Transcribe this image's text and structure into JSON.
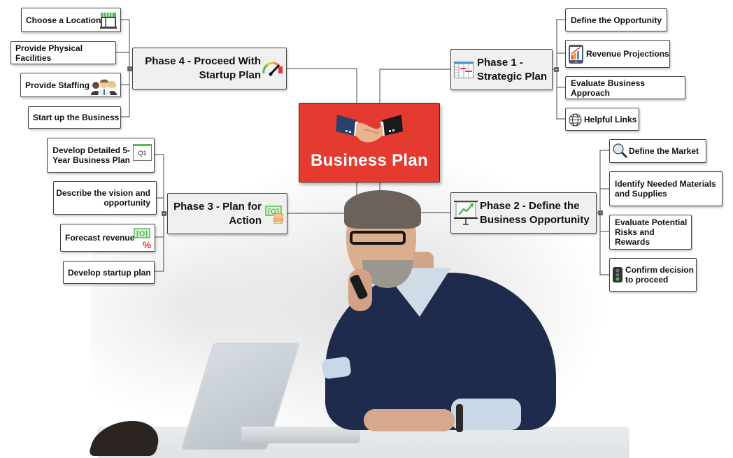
{
  "central_topic": {
    "title": "Business Plan",
    "icon": "handshake-icon",
    "fill_color": "#e43a2f"
  },
  "phases": [
    {
      "id": "phase1",
      "label": "Phase 1 -\nStrategic Plan",
      "icon": "gantt-chart-icon",
      "children": [
        {
          "label": "Define the Opportunity",
          "icon": null
        },
        {
          "label": "Revenue Projections",
          "icon": "tablet-chart-icon"
        },
        {
          "label": "Evaluate Business Approach",
          "icon": null
        },
        {
          "label": "Helpful Links",
          "icon": "globe-icon"
        }
      ]
    },
    {
      "id": "phase2",
      "label": "Phase 2 - Define the\nBusiness Opportunity",
      "icon": "presentation-board-icon",
      "children": [
        {
          "label": "Define the Market",
          "icon": "magnifier-icon"
        },
        {
          "label": "Identify Needed Materials\nand Supplies",
          "icon": null
        },
        {
          "label": "Evaluate Potential\nRisks and Rewards",
          "icon": null
        },
        {
          "label": "Confirm decision\nto proceed",
          "icon": "traffic-light-icon"
        }
      ]
    },
    {
      "id": "phase3",
      "label": "Phase 3 - Plan for\nAction",
      "icon": "money-coins-icon",
      "children": [
        {
          "label": "Develop Detailed 5-\nYear Business Plan",
          "icon": "calendar-q1-icon",
          "icon_text": "Q1"
        },
        {
          "label": "Describe the vision and\nopportunity",
          "icon": null
        },
        {
          "label": "Forecast revenue",
          "icon": "money-percent-icon",
          "icon_text": "%"
        },
        {
          "label": "Develop startup plan",
          "icon": null
        }
      ]
    },
    {
      "id": "phase4",
      "label": "Phase 4 - Proceed With\nStartup Plan",
      "icon": "gauge-icon",
      "children": [
        {
          "label": "Choose a Location",
          "icon": "storefront-icon"
        },
        {
          "label": "Provide Physical Facilities",
          "icon": null
        },
        {
          "label": "Provide Staffing",
          "icon": "team-people-icon"
        },
        {
          "label": "Start up the Business",
          "icon": null
        }
      ]
    }
  ]
}
